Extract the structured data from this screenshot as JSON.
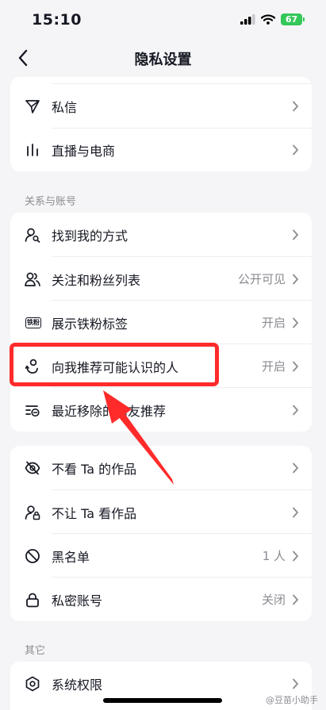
{
  "status_bar": {
    "time": "15:10",
    "battery": "67"
  },
  "nav": {
    "title": "隐私设置"
  },
  "group1": [
    {
      "icon": "send-icon",
      "label": "私信",
      "value": ""
    },
    {
      "icon": "live-stats-icon",
      "label": "直播与电商",
      "value": ""
    }
  ],
  "section_relations": "关系与账号",
  "group2": [
    {
      "icon": "find-me-icon",
      "label": "找到我的方式",
      "value": ""
    },
    {
      "icon": "followers-icon",
      "label": "关注和粉丝列表",
      "value": "公开可见"
    },
    {
      "icon": "fan-badge-icon",
      "badge_text": "铁粉",
      "label": "展示铁粉标签",
      "value": "开启"
    },
    {
      "icon": "recommend-icon",
      "label": "向我推荐可能认识的人",
      "value": "开启"
    },
    {
      "icon": "removed-list-icon",
      "label": "最近移除的朋友推荐",
      "value": ""
    }
  ],
  "group3": [
    {
      "icon": "eye-off-icon",
      "label": "不看 Ta 的作品",
      "value": ""
    },
    {
      "icon": "user-lock-icon",
      "label": "不让 Ta 看作品",
      "value": ""
    },
    {
      "icon": "block-icon",
      "label": "黑名单",
      "value": "1 人"
    },
    {
      "icon": "lock-icon",
      "label": "私密账号",
      "value": "关闭"
    }
  ],
  "section_other": "其它",
  "group4": [
    {
      "icon": "hexagon-settings-icon",
      "label": "系统权限",
      "value": ""
    }
  ],
  "annotation": {
    "highlight_color": "#ff2b2b"
  },
  "watermark": "@豆苗小助手"
}
